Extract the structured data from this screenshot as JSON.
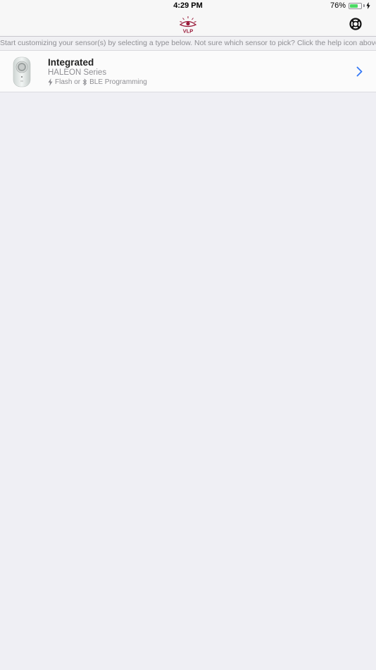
{
  "status_bar": {
    "time": "4:29 PM",
    "battery_percent": "76%",
    "battery_level": 0.76,
    "battery_color": "#4cd964"
  },
  "nav_bar": {
    "logo_text": "VLP",
    "logo_color": "#9a1b3a",
    "help_icon": "lifebuoy-icon"
  },
  "instruction_text": "Start customizing your sensor(s) by selecting a type below. Not sure which sensor to pick? Click the help icon above.",
  "sensor_types": [
    {
      "title": "Integrated",
      "series": "HALEON Series",
      "flash_label": "Flash or",
      "ble_label": "BLE Programming",
      "thumbnail": "sensor-device-image",
      "accessory_icon": "chevron-right-icon",
      "accent": "#3478f6"
    }
  ]
}
